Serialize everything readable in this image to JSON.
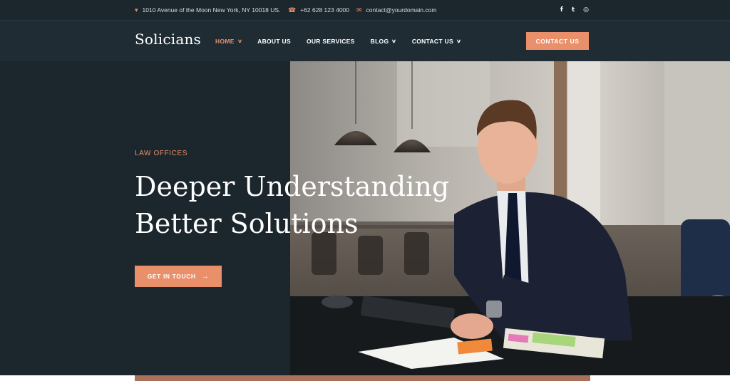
{
  "topbar": {
    "address": "1010 Avenue of the Moon New York, NY 10018 US.",
    "phone": "+62 628 123 4000",
    "email": "contact@yourdomain.com",
    "icons": {
      "address": "map-pin-icon",
      "phone": "phone-icon",
      "email": "envelope-icon"
    },
    "social": {
      "facebook": "f",
      "twitter": "t",
      "instagram": "◎"
    }
  },
  "nav": {
    "logo": "Solicians",
    "items": [
      {
        "label": "HOME",
        "has_dropdown": true,
        "active": true
      },
      {
        "label": "ABOUT US",
        "has_dropdown": false,
        "active": false
      },
      {
        "label": "OUR SERVICES",
        "has_dropdown": false,
        "active": false
      },
      {
        "label": "BLOG",
        "has_dropdown": true,
        "active": false
      },
      {
        "label": "CONTACT US",
        "has_dropdown": true,
        "active": false
      }
    ],
    "cta": "CONTACT US"
  },
  "hero": {
    "eyebrow": "LAW OFFICES",
    "headline_line1": "Deeper Understanding",
    "headline_line2": "Better Solutions",
    "cta": "GET IN TOUCH",
    "cta_icon": "arrow-right-icon"
  },
  "colors": {
    "accent": "#e9906a",
    "dark_bg": "#1b262d",
    "nav_bg": "#1f2c34",
    "strip": "#a9705a"
  }
}
